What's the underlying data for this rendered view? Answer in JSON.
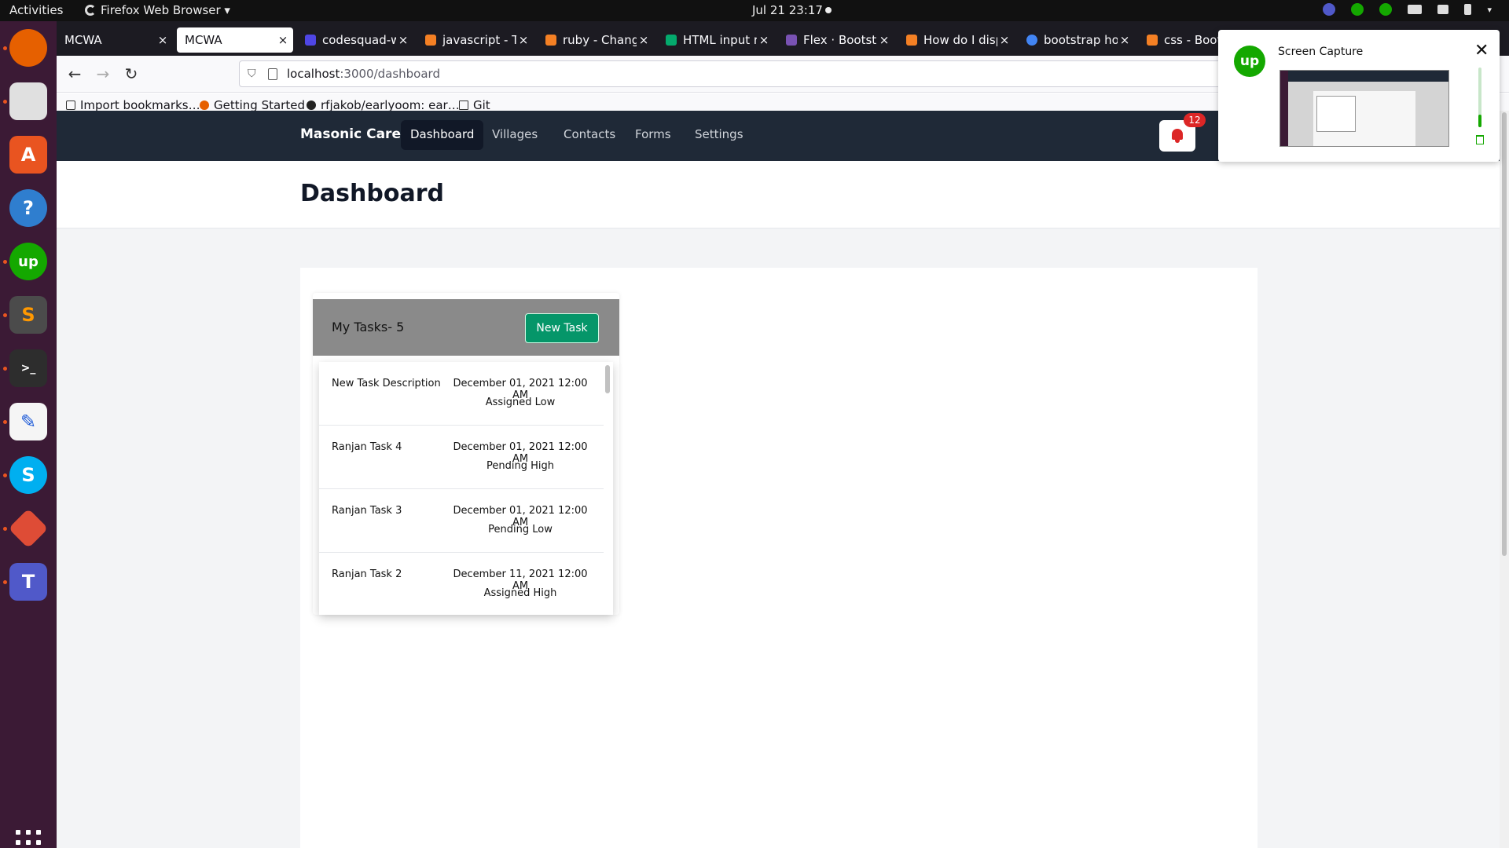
{
  "system_bar": {
    "activities": "Activities",
    "app_menu": "Firefox Web Browser ▾",
    "clock": "Jul 21  23:17"
  },
  "dock": {
    "apps": [
      "firefox-icon",
      "files-icon",
      "app-center-icon",
      "help-icon",
      "upwork-icon",
      "sublime-text-icon",
      "terminal-icon",
      "text-editor-icon",
      "skype-icon",
      "git-icon",
      "teams-icon"
    ]
  },
  "browser": {
    "tabs": [
      {
        "title": "MCWA",
        "active": false
      },
      {
        "title": "MCWA",
        "active": true
      },
      {
        "title": "codesquad-wa",
        "active": false
      },
      {
        "title": "javascript - Ty",
        "active": false
      },
      {
        "title": "ruby - Change",
        "active": false
      },
      {
        "title": "HTML input re",
        "active": false
      },
      {
        "title": "Flex · Bootstra",
        "active": false
      },
      {
        "title": "How do I displ",
        "active": false
      },
      {
        "title": "bootstrap hor",
        "active": false
      },
      {
        "title": "css - Bootstr",
        "active": false
      }
    ],
    "tab_close": "×",
    "url_host": "localhost",
    "url_path": ":3000/dashboard",
    "bookmarks": [
      "Import bookmarks…",
      "Getting Started",
      "rfjakob/earlyoom: ear…",
      "Git"
    ]
  },
  "app": {
    "brand": "Masonic Care",
    "nav": [
      "Dashboard",
      "Villages",
      "Contacts",
      "Forms",
      "Settings"
    ],
    "active_nav": "Dashboard",
    "notifications_count": "12",
    "page_title": "Dashboard",
    "tasks": {
      "header": "My Tasks- 5",
      "new_task_label": "New Task",
      "items": [
        {
          "name": "New Task Description",
          "date": "December 01, 2021 12:00 AM",
          "status": "Assigned Low"
        },
        {
          "name": "Ranjan Task 4",
          "date": "December 01, 2021 12:00 AM",
          "status": "Pending High"
        },
        {
          "name": "Ranjan Task 3",
          "date": "December 01, 2021 12:00 AM",
          "status": "Pending Low"
        },
        {
          "name": "Ranjan Task 2",
          "date": "December 11, 2021 12:00 AM",
          "status": "Assigned High"
        }
      ]
    }
  },
  "screen_capture": {
    "logo_text": "up",
    "title": "Screen Capture",
    "close": "✕"
  },
  "colors": {
    "app_nav_bg": "#1f2937",
    "new_task_button": "#059669",
    "badge": "#dc2626",
    "upwork_green": "#14a800",
    "dock_bg": "#3b1a35"
  }
}
